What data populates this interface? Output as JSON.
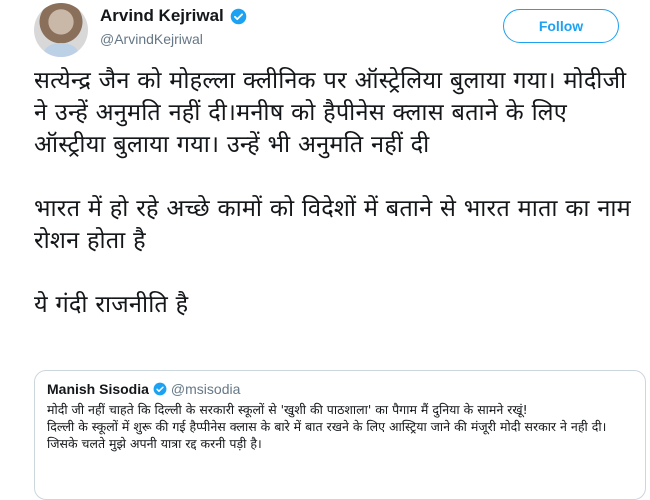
{
  "header": {
    "name": "Arvind Kejriwal",
    "handle": "@ArvindKejriwal",
    "follow_label": "Follow"
  },
  "tweet": {
    "paragraphs": [
      "सत्येन्द्र जैन को मोहल्ला क्लीनिक पर ऑस्ट्रेलिया बुलाया गया। मोदीजी ने उन्हें अनुमति नहीं दी।मनीष को हैपीनेस क्लास बताने के लिए ऑस्ट्रीया बुलाया गया। उन्हें भी अनुमति नहीं दी",
      "भारत में हो रहे अच्छे कामों को विदेशों में बताने से भारत माता का नाम रोशन होता है",
      "ये गंदी राजनीति है"
    ]
  },
  "quoted_tweet": {
    "name": "Manish Sisodia",
    "handle": "@msisodia",
    "paragraphs": [
      "मोदी जी नहीं चाहते कि दिल्ली के सरकारी स्कूलों से 'खुशी की पाठशाला' का पैगाम मैं दुनिया के सामने रखूं!",
      "दिल्ली के स्कूलों में शुरू की गई हैप्पीनेस क्लास के बारे में बात रखने के लिए आस्ट्रिया जाने की मंजूरी मोदी सरकार ने नही दी। जिसके चलते मुझे अपनी यात्रा रद्द करनी पड़ी है।"
    ]
  },
  "colors": {
    "brand_blue": "#1da1f2",
    "text_primary": "#14171a",
    "text_secondary": "#657786",
    "border": "#ccd6dd"
  },
  "icons": [
    "avatar",
    "verified-badge-icon"
  ]
}
